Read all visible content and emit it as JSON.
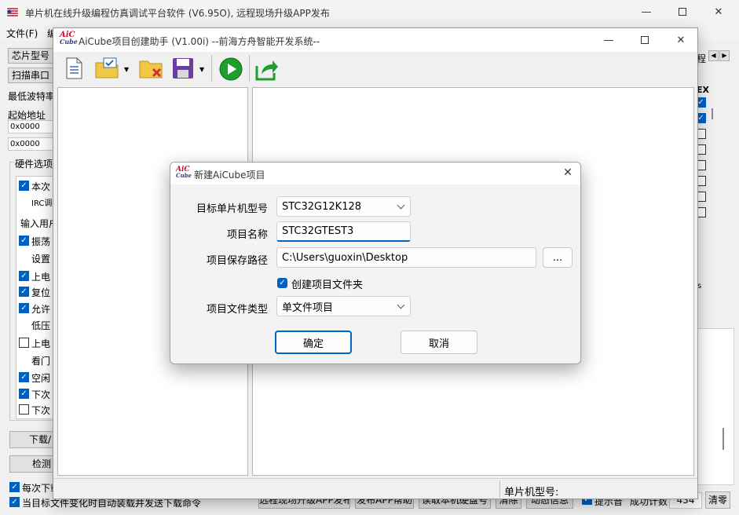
{
  "main_window": {
    "title": "单片机在线升级编程仿真调试平台软件 (V6.95O), 远程现场升级APP发布",
    "menu": {
      "file": "文件(F)",
      "edit": "编"
    },
    "left": {
      "chip_type_btn": "芯片型号",
      "scan_port_btn": "扫描串口",
      "min_baud_label": "最低波特率",
      "start_addr_label": "起始地址",
      "addr1": "0x0000",
      "addr2": "0x0000",
      "hw_options_label": "硬件选项",
      "opt_rows": [
        {
          "text": "本次",
          "cb": "on"
        },
        {
          "text": "IRC调",
          "cb": "none"
        },
        {
          "text": "输入用户",
          "cb": "none"
        },
        {
          "text": "振荡",
          "cb": "on"
        },
        {
          "text": "设置",
          "cb": "none"
        },
        {
          "text": "上电",
          "cb": "on"
        },
        {
          "text": "复位",
          "cb": "on"
        },
        {
          "text": "允许",
          "cb": "on"
        },
        {
          "text": "低压",
          "cb": "none"
        },
        {
          "text": "上电",
          "cb": "off"
        },
        {
          "text": "看门",
          "cb": "none"
        },
        {
          "text": "空闲",
          "cb": "on"
        },
        {
          "text": "下次",
          "cb": "on"
        },
        {
          "text": "下次",
          "cb": "off"
        }
      ],
      "download_btn": "下载/",
      "detect_btn": "检测",
      "every_download": "每次下载",
      "auto_load": "当目标文件变化时自动装载并发送下载命令"
    },
    "right_fragments": {
      "tab_text": "程",
      "hex": "EX",
      "s_text": "s"
    },
    "bottom": {
      "remote_publish_btn": "远程现场升级APP发布",
      "publish_help_btn": "发布APP帮助",
      "read_disk_btn": "读取本机硬盘号",
      "clear_btn": "清除",
      "animation_btn": "动态信息",
      "tip_sound_label": "提示音",
      "success_count_label": "成功计数",
      "count_value": "434",
      "reset_btn": "清零"
    }
  },
  "aicube_window": {
    "logo_top": "AiC",
    "logo_bottom": "Cube",
    "title": "AiCube项目创建助手 (V1.00i) --前海方舟智能开发系统--",
    "status_label": "单片机型号:"
  },
  "dialog": {
    "title": "新建AiCube项目",
    "mcu_label": "目标单片机型号",
    "mcu_value": "STC32G12K128",
    "name_label": "项目名称",
    "name_value": "STC32GTEST3",
    "path_label": "项目保存路径",
    "path_value": "C:\\Users\\guoxin\\Desktop",
    "browse_btn": "...",
    "create_folder_label": "创建项目文件夹",
    "type_label": "项目文件类型",
    "type_value": "单文件项目",
    "ok_btn": "确定",
    "cancel_btn": "取消"
  },
  "colors": {
    "accent": "#0067c0",
    "play_green": "#1e9e2a",
    "folder_yellow": "#f2c744"
  }
}
